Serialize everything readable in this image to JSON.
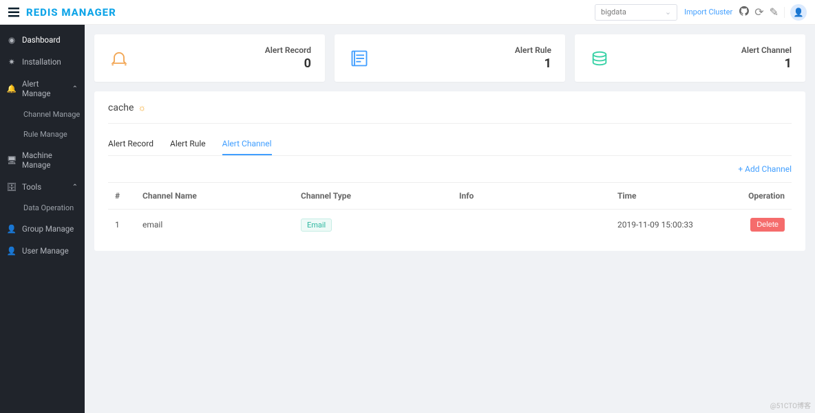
{
  "brand": "REDIS MANAGER",
  "header": {
    "cluster_selected": "bigdata",
    "import_label": "Import Cluster"
  },
  "sidebar": {
    "items": [
      {
        "label": "Dashboard",
        "icon": "dashboard"
      },
      {
        "label": "Installation",
        "icon": "deploy"
      },
      {
        "label": "Alert Manage",
        "icon": "bell",
        "expanded": true,
        "children": [
          {
            "label": "Channel Manage"
          },
          {
            "label": "Rule Manage"
          }
        ]
      },
      {
        "label": "Machine Manage",
        "icon": "monitor"
      },
      {
        "label": "Tools",
        "icon": "toolbox",
        "expanded": true,
        "children": [
          {
            "label": "Data Operation"
          }
        ]
      },
      {
        "label": "Group Manage",
        "icon": "user"
      },
      {
        "label": "User Manage",
        "icon": "user-o"
      }
    ]
  },
  "cards": [
    {
      "icon": "bell-ring",
      "label": "Alert Record",
      "value": "0"
    },
    {
      "icon": "list-box",
      "label": "Alert Rule",
      "value": "1"
    },
    {
      "icon": "coins",
      "label": "Alert Channel",
      "value": "1"
    }
  ],
  "panel": {
    "title": "cache"
  },
  "tabs": [
    {
      "label": "Alert Record"
    },
    {
      "label": "Alert Rule"
    },
    {
      "label": "Alert Channel"
    }
  ],
  "add_channel_label": "Add Channel",
  "table": {
    "headers": [
      "#",
      "Channel Name",
      "Channel Type",
      "Info",
      "Time",
      "Operation"
    ],
    "rows": [
      {
        "idx": "1",
        "name": "email",
        "type": "Email",
        "info": "",
        "time": "2019-11-09 15:00:33",
        "op": "Delete"
      }
    ]
  },
  "watermark": "@51CTO博客"
}
